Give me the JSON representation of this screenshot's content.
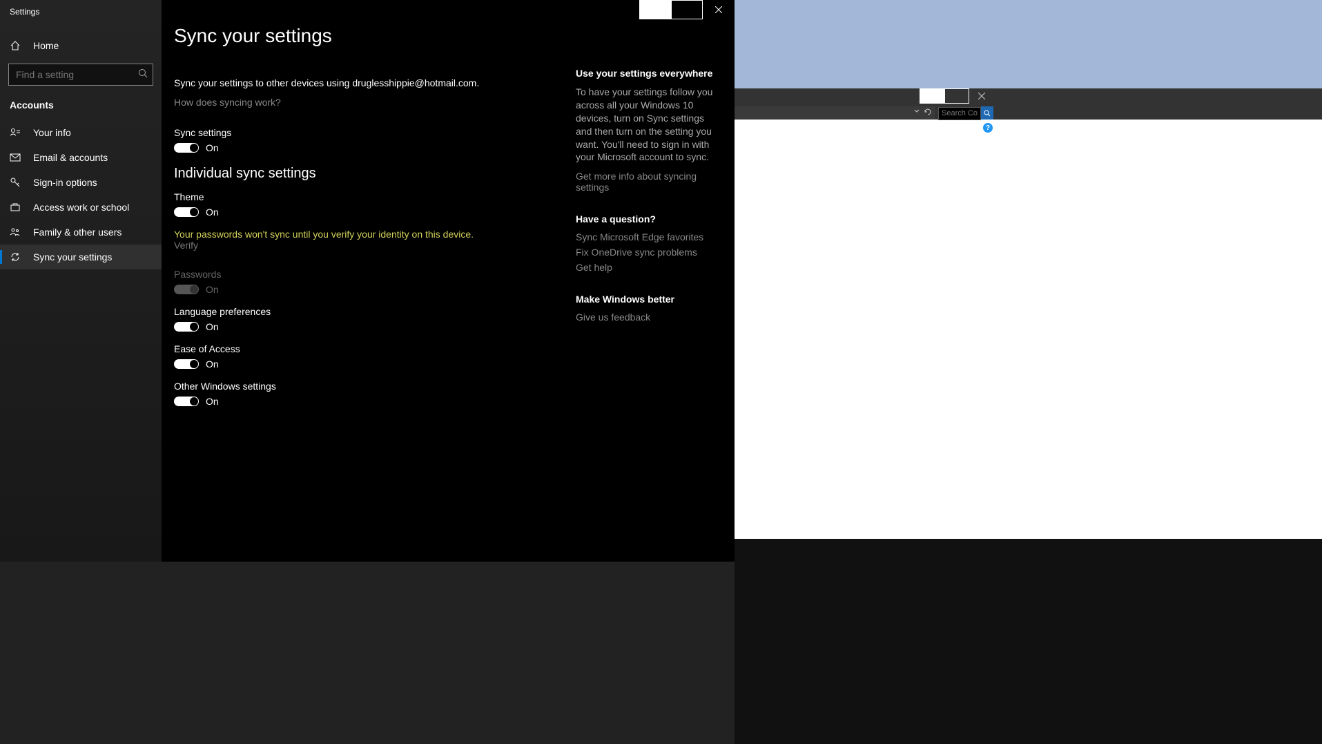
{
  "window": {
    "title": "Settings"
  },
  "sidebar": {
    "home": "Home",
    "search_placeholder": "Find a setting",
    "section": "Accounts",
    "items": [
      {
        "label": "Your info"
      },
      {
        "label": "Email & accounts"
      },
      {
        "label": "Sign-in options"
      },
      {
        "label": "Access work or school"
      },
      {
        "label": "Family & other users"
      },
      {
        "label": "Sync your settings"
      }
    ]
  },
  "page": {
    "title": "Sync your settings",
    "description": "Sync your settings to other devices using druglesshippie@hotmail.com.",
    "how_link": "How does syncing work?",
    "sync_settings_label": "Sync settings",
    "individual_heading": "Individual sync settings",
    "warning_text": "Your passwords won't sync until you verify your identity on this device.",
    "verify_text": "Verify",
    "toggles": {
      "sync": {
        "label": "Sync settings",
        "state": "On"
      },
      "theme": {
        "label": "Theme",
        "state": "On"
      },
      "passwords": {
        "label": "Passwords",
        "state": "On"
      },
      "language": {
        "label": "Language preferences",
        "state": "On"
      },
      "ease": {
        "label": "Ease of Access",
        "state": "On"
      },
      "other": {
        "label": "Other Windows settings",
        "state": "On"
      }
    }
  },
  "side": {
    "group1": {
      "heading": "Use your settings everywhere",
      "text": "To have your settings follow you across all your Windows 10 devices, turn on Sync settings and then turn on the setting you want. You'll need to sign in with your Microsoft account to sync.",
      "link": "Get more info about syncing settings"
    },
    "group2": {
      "heading": "Have a question?",
      "links": [
        "Sync Microsoft Edge favorites",
        "Fix OneDrive sync problems",
        "Get help"
      ]
    },
    "group3": {
      "heading": "Make Windows better",
      "link": "Give us feedback"
    }
  },
  "bg_window": {
    "search_placeholder": "Search Co..."
  }
}
